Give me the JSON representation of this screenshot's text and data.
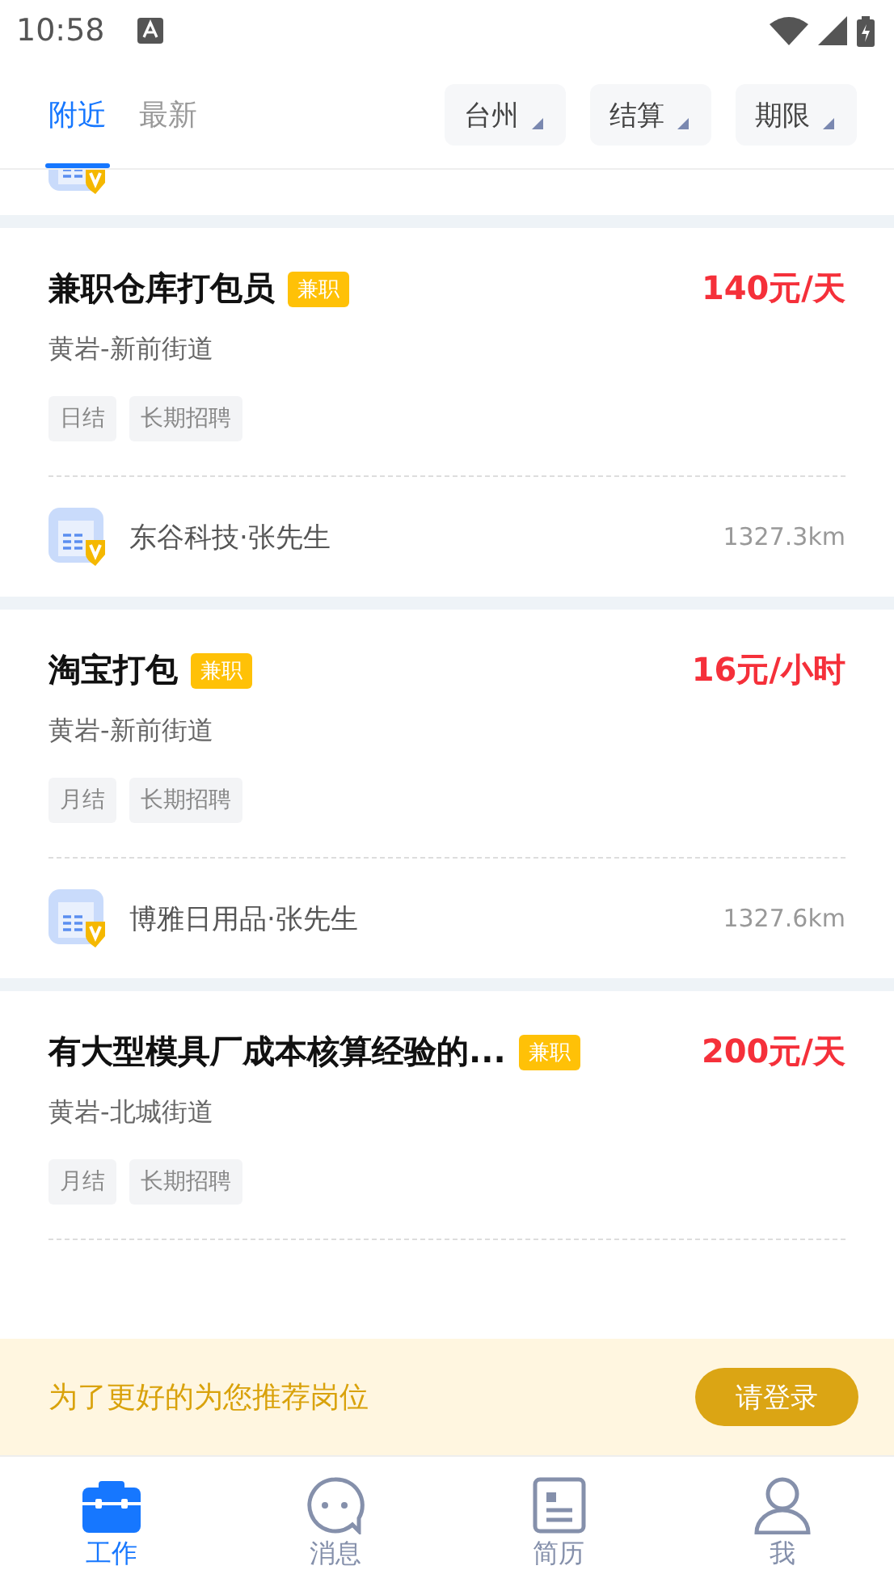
{
  "status_bar": {
    "time": "10:58"
  },
  "tabs": [
    {
      "label": "附近",
      "selected": true
    },
    {
      "label": "最新",
      "selected": false
    }
  ],
  "filters": [
    "台州",
    "结算",
    "期限"
  ],
  "jobs": [
    {
      "title": "兼职仓库打包员",
      "badge": "兼职",
      "salary": "140元/天",
      "location": "黄岩-新前街道",
      "tags": [
        "日结",
        "长期招聘"
      ],
      "company": "东谷科技·张先生",
      "distance": "1327.3km"
    },
    {
      "title": "淘宝打包",
      "badge": "兼职",
      "salary": "16元/小时",
      "location": "黄岩-新前街道",
      "tags": [
        "月结",
        "长期招聘"
      ],
      "company": "博雅日用品·张先生",
      "distance": "1327.6km"
    },
    {
      "title": "有大型模具厂成本核算经验的...",
      "badge": "兼职",
      "salary": "200元/天",
      "location": "黄岩-北城街道",
      "tags": [
        "月结",
        "长期招聘"
      ]
    }
  ],
  "login_banner": {
    "message": "为了更好的为您推荐岗位",
    "button": "请登录"
  },
  "bottom_nav": [
    {
      "label": "工作",
      "kind": "work",
      "selected": true
    },
    {
      "label": "消息",
      "kind": "message",
      "selected": false
    },
    {
      "label": "简历",
      "kind": "resume",
      "selected": false
    },
    {
      "label": "我",
      "kind": "me",
      "selected": false
    }
  ]
}
